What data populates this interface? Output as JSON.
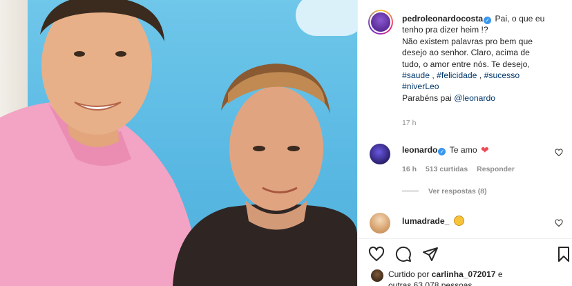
{
  "post": {
    "author": "pedroleonardocosta",
    "caption_lines": [
      "Pai, o que eu",
      "tenho pra dizer heim !?",
      "Não existem palavras pro bem que",
      "desejo ao senhor. Claro, acima de",
      "tudo, o amor entre nós. Te desejo,"
    ],
    "hashtags_line1": [
      "#saude",
      "#felicidade",
      "#sucesso"
    ],
    "hashtags_line2": "#niverLeo",
    "mention_prefix": "Parabéns pai",
    "mention": "@leonardo",
    "time": "17 h"
  },
  "comments": [
    {
      "user": "leonardo",
      "text": "Te amo",
      "time": "16 h",
      "likes": "513 curtidas",
      "reply_label": "Responder",
      "view_replies": "Ver respostas (8)"
    },
    {
      "user": "lumadrade_"
    }
  ],
  "likes": {
    "prefix": "Curtido por",
    "user": "carlinha_072017",
    "suffix": "e",
    "others": "outras 63.078 pessoas"
  },
  "icons": {
    "verified": "verified-badge-icon",
    "like": "heart-outline-icon",
    "comment": "speech-bubble-icon",
    "share": "paper-plane-icon",
    "save": "bookmark-icon",
    "red_heart": "red-heart-emoji",
    "clap": "clapping-hands-emoji"
  },
  "colors": {
    "verified": "#3897f0",
    "tag_link": "#00376b",
    "muted": "#8e8e8e",
    "heart": "#ed4956",
    "photo_sky": "#5ab9e3",
    "pink_shirt": "#f2a0c0"
  }
}
